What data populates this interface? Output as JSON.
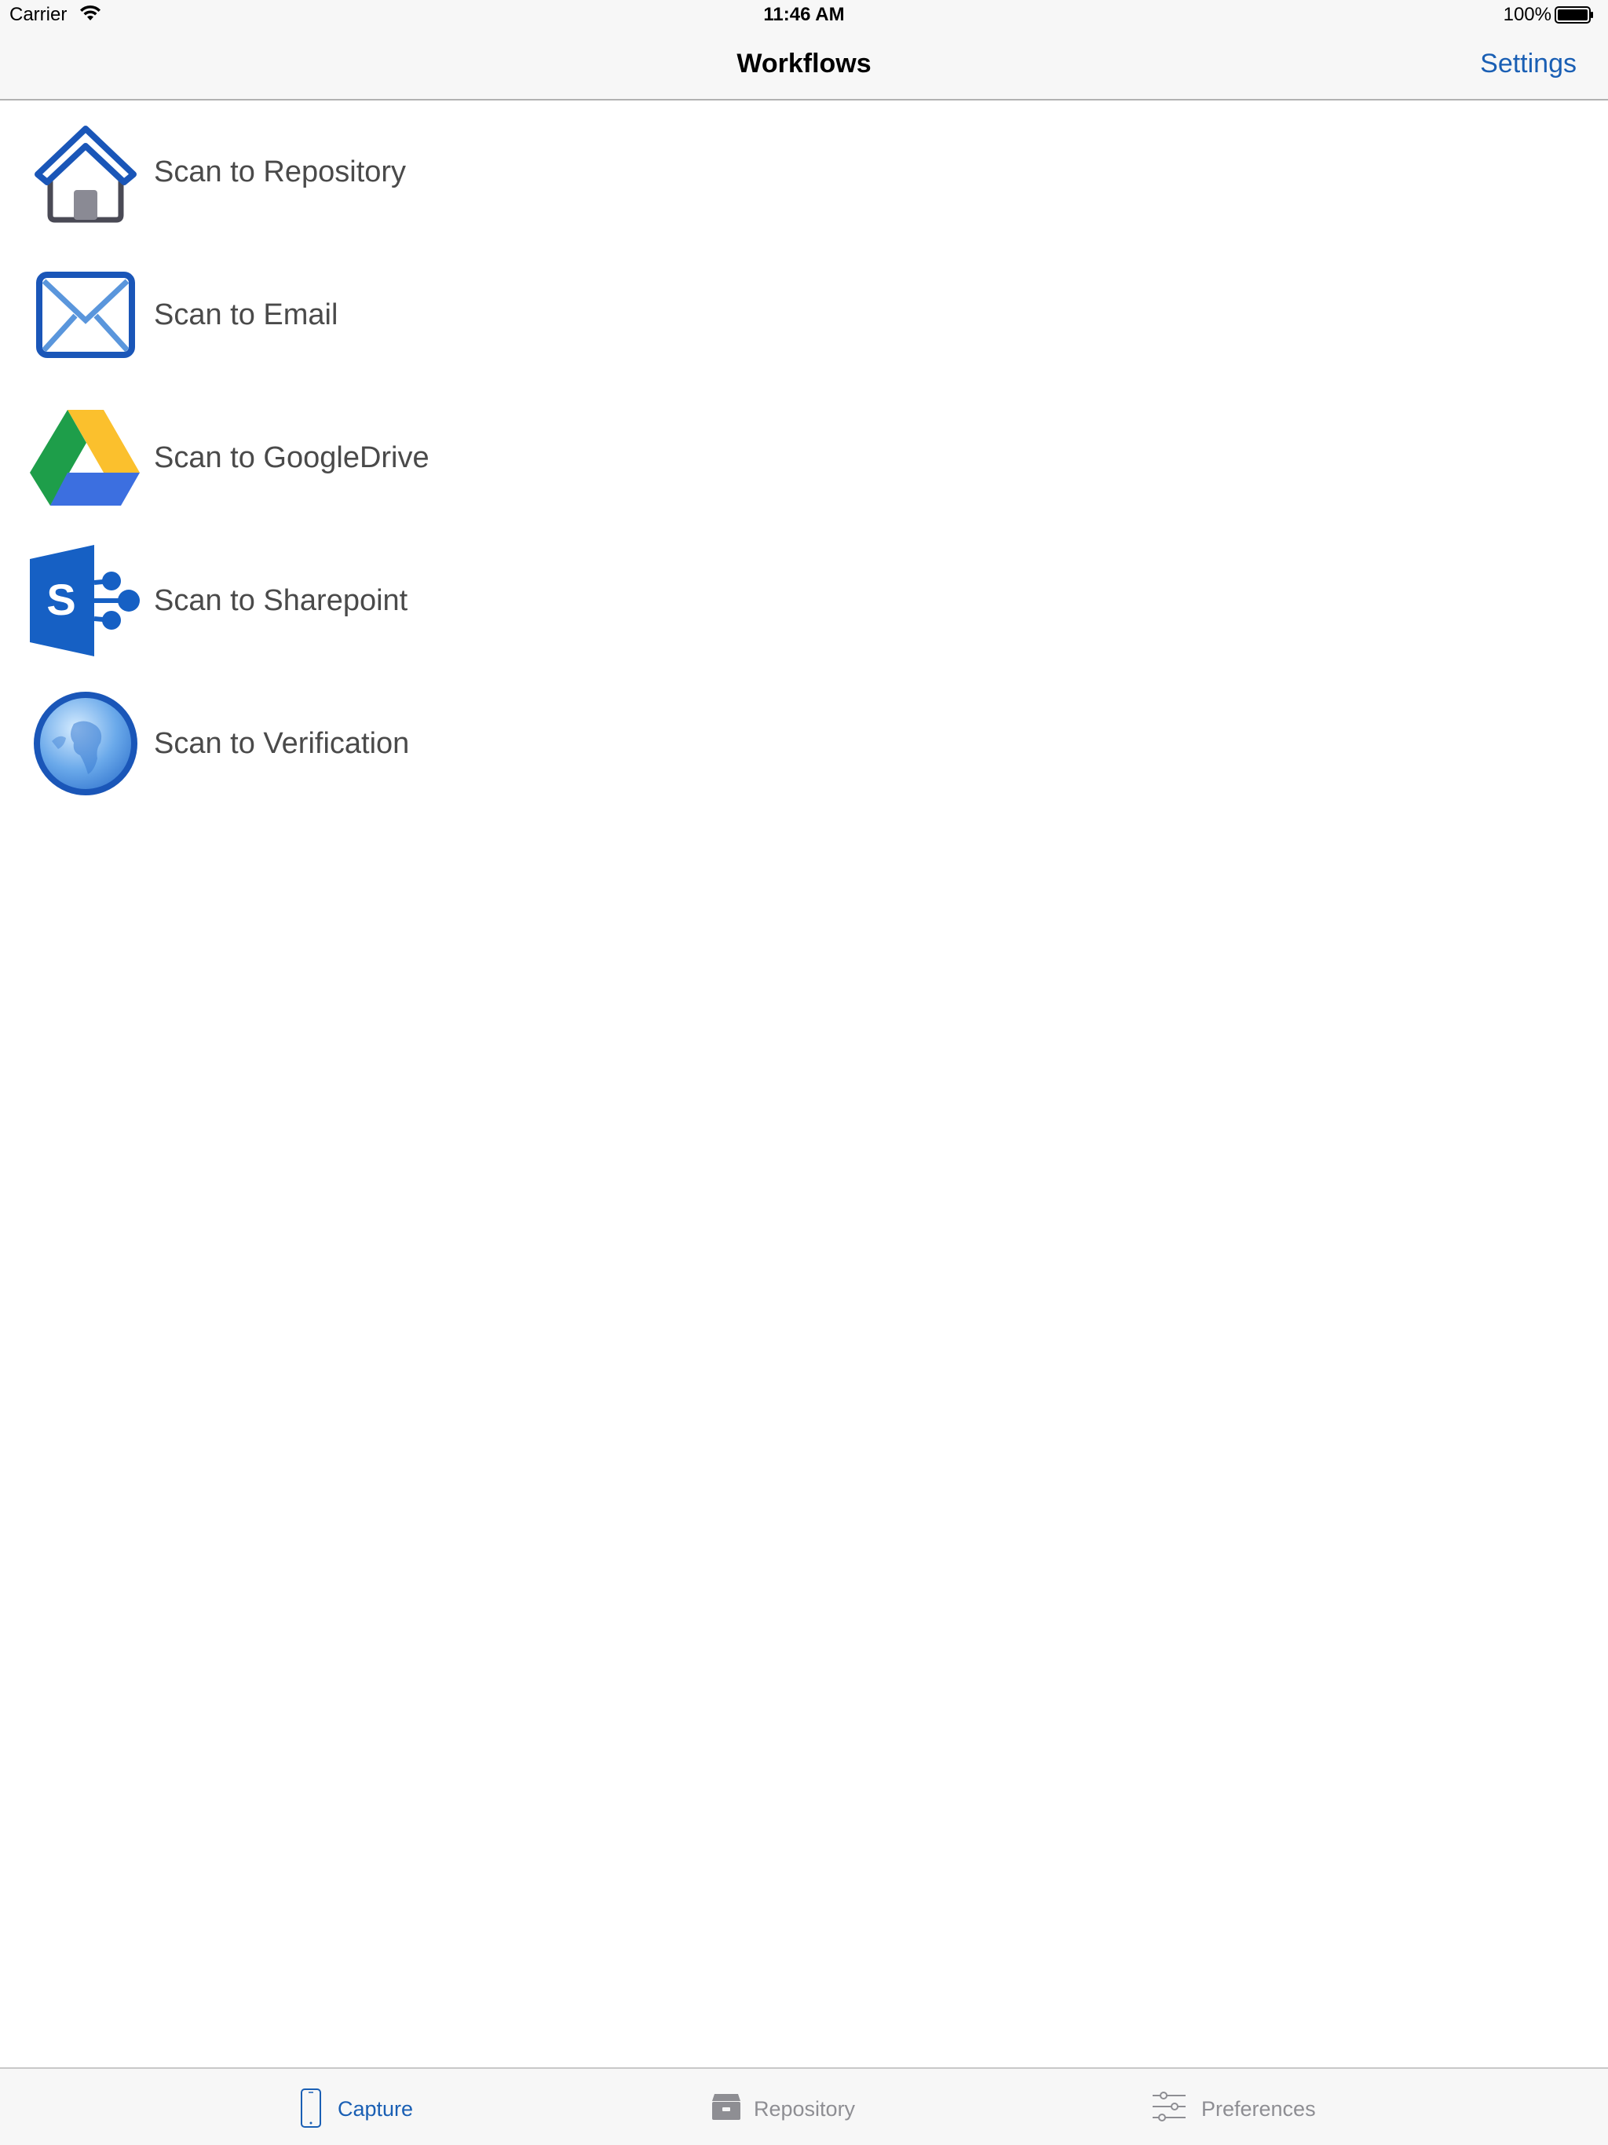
{
  "status_bar": {
    "carrier": "Carrier",
    "time": "11:46 AM",
    "battery": "100%",
    "wifi_icon": "wifi-icon",
    "battery_icon": "battery-icon"
  },
  "nav": {
    "title": "Workflows",
    "settings_label": "Settings"
  },
  "workflows": [
    {
      "label": "Scan to Repository",
      "icon": "house-icon"
    },
    {
      "label": "Scan to Email",
      "icon": "envelope-icon"
    },
    {
      "label": "Scan to GoogleDrive",
      "icon": "google-drive-icon"
    },
    {
      "label": "Scan to Sharepoint",
      "icon": "sharepoint-icon"
    },
    {
      "label": "Scan to Verification",
      "icon": "globe-icon"
    }
  ],
  "tabs": [
    {
      "label": "Capture",
      "icon": "phone-icon",
      "selected": true
    },
    {
      "label": "Repository",
      "icon": "archive-box-icon",
      "selected": false
    },
    {
      "label": "Preferences",
      "icon": "sliders-icon",
      "selected": false
    }
  ],
  "colors": {
    "accent": "#1a5fb4",
    "tab_inactive": "#8e8e93",
    "bar_background": "#f7f7f7"
  }
}
